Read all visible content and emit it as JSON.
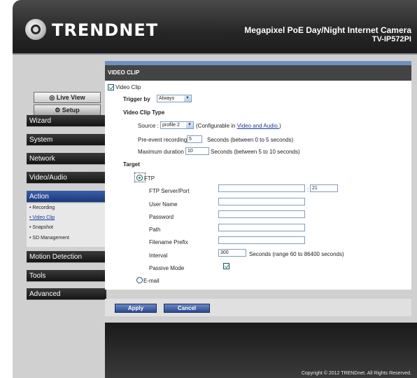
{
  "header": {
    "logo_text": "TRENDNET",
    "product_name": "Megapixel PoE Day/Night Internet Camera",
    "product_model": "TV-IP572PI"
  },
  "sidebar": {
    "live_view": "Live View",
    "setup": "Setup",
    "menu": [
      "Wizard",
      "System",
      "Network",
      "Video/Audio",
      "Action"
    ],
    "action_sub": [
      "• Recording",
      "• Video Clip",
      "• Snapshot",
      "• SD Management"
    ],
    "menu2": [
      "Motion Detection",
      "Tools",
      "Advanced"
    ]
  },
  "panel": {
    "title": "VIDEO CLIP",
    "video_clip_check": "Video Clip",
    "trigger_by_label": "Trigger by",
    "trigger_by_value": "Always",
    "video_clip_type": "Video Clip Type",
    "source_label": "Source :",
    "source_value": "profile 2",
    "source_hint_pre": "(Configurable in",
    "source_hint_link": "Video and Audio.",
    "source_hint_post": ")",
    "pre_event_label": "Pre-event recording",
    "pre_event_value": "5",
    "pre_event_hint": "Seconds (between 0 to 5 seconds)",
    "max_duration_label": "Maximum duration",
    "max_duration_value": "10",
    "max_duration_hint": "Seconds (between 5 to 10 seconds)",
    "target_label": "Target",
    "ftp_label": "FTP",
    "ftp_server_label": "FTP Server/Port",
    "ftp_server_value": "",
    "port_sep": ":",
    "port_value": "21",
    "user_name_label": "User Name",
    "password_label": "Password",
    "path_label": "Path",
    "filename_prefix_label": "Filename Prefix",
    "interval_label": "Interval",
    "interval_value": "300",
    "interval_hint": "Seconds  (range 60 to 86400 seconds)",
    "passive_mode_label": "Passive Mode",
    "email_label": "E-mail"
  },
  "buttons": {
    "apply": "Apply",
    "cancel": "Cancel"
  },
  "footer": {
    "copyright": "Copyright © 2012 TRENDnet. All Rights Reserved."
  }
}
